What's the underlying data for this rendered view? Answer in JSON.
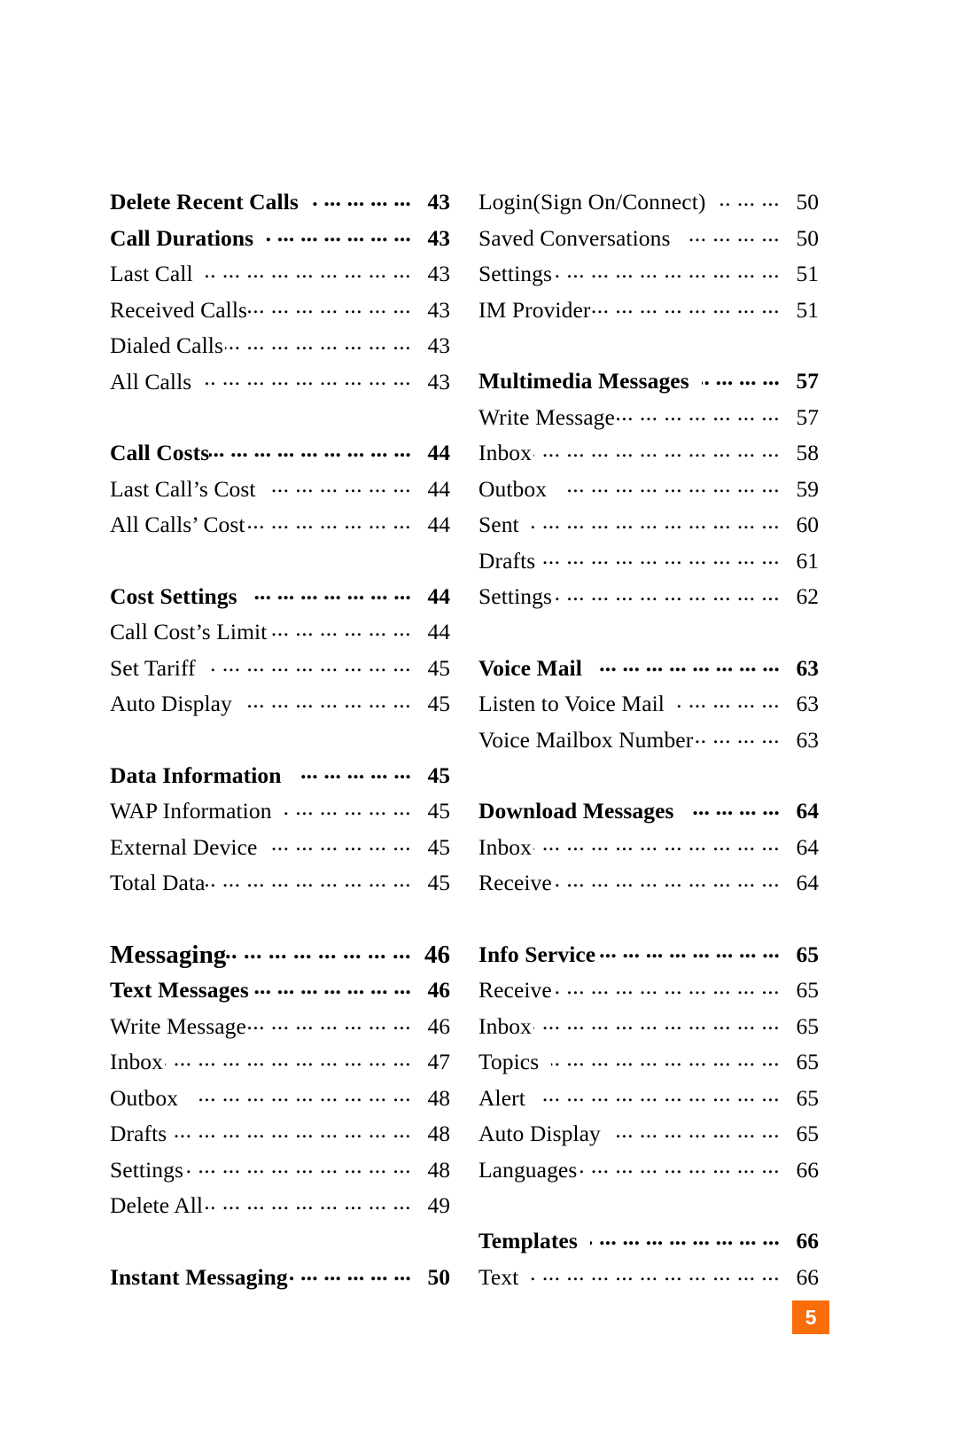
{
  "page": {
    "number": "5",
    "badge_color": "#f96d0b",
    "badge_text_color": "#ffffff"
  },
  "toc": {
    "left_column": [
      {
        "label": "Delete Recent Calls",
        "page": "43",
        "level": "head",
        "spacing": "none",
        "leader": "wide"
      },
      {
        "label": "Call Durations",
        "page": "43",
        "level": "head",
        "spacing": "none",
        "leader": "wide"
      },
      {
        "label": "Last Call",
        "page": "43",
        "level": "sub",
        "spacing": "none",
        "leader": "wide"
      },
      {
        "label": "Received Calls",
        "page": "43",
        "level": "sub",
        "spacing": "none",
        "leader": "tight"
      },
      {
        "label": "Dialed Calls",
        "page": "43",
        "level": "sub",
        "spacing": "none",
        "leader": "normal"
      },
      {
        "label": "All Calls",
        "page": "43",
        "level": "sub",
        "spacing": "none",
        "leader": "wide"
      },
      {
        "label": "Call Costs",
        "page": "44",
        "level": "head",
        "spacing": "gap",
        "leader": "tight"
      },
      {
        "label": "Last Call’s Cost",
        "page": "44",
        "level": "sub",
        "spacing": "none",
        "leader": "wide"
      },
      {
        "label": "All Calls’ Cost",
        "page": "44",
        "level": "sub",
        "spacing": "none",
        "leader": "normal"
      },
      {
        "label": "Cost Settings",
        "page": "44",
        "level": "head",
        "spacing": "gap",
        "leader": "wide"
      },
      {
        "label": "Call Cost’s Limit",
        "page": "44",
        "level": "sub",
        "spacing": "none",
        "leader": "normal"
      },
      {
        "label": "Set Tariff",
        "page": "45",
        "level": "sub",
        "spacing": "none",
        "leader": "wide"
      },
      {
        "label": "Auto Display",
        "page": "45",
        "level": "sub",
        "spacing": "none",
        "leader": "wide"
      },
      {
        "label": "Data Information",
        "page": "45",
        "level": "head",
        "spacing": "gap",
        "leader": "wide"
      },
      {
        "label": "WAP Information",
        "page": "45",
        "level": "sub",
        "spacing": "none",
        "leader": "wide"
      },
      {
        "label": "External Device",
        "page": "45",
        "level": "sub",
        "spacing": "none",
        "leader": "wide"
      },
      {
        "label": "Total Data",
        "page": "45",
        "level": "sub",
        "spacing": "none",
        "leader": "tight"
      },
      {
        "label": "Messaging",
        "page": "46",
        "level": "major",
        "spacing": "gap",
        "leader": "tight"
      },
      {
        "label": "Text Messages",
        "page": "46",
        "level": "head",
        "spacing": "none",
        "leader": "tight"
      },
      {
        "label": "Write Message",
        "page": "46",
        "level": "sub",
        "spacing": "none",
        "leader": "normal"
      },
      {
        "label": "Inbox",
        "page": "47",
        "level": "sub",
        "spacing": "none",
        "leader": "normal"
      },
      {
        "label": "Outbox",
        "page": "48",
        "level": "sub",
        "spacing": "none",
        "leader": "wide"
      },
      {
        "label": "Drafts",
        "page": "48",
        "level": "sub",
        "spacing": "none",
        "leader": "tight"
      },
      {
        "label": "Settings",
        "page": "48",
        "level": "sub",
        "spacing": "none",
        "leader": "normal"
      },
      {
        "label": "Delete All",
        "page": "49",
        "level": "sub",
        "spacing": "none",
        "leader": "normal"
      },
      {
        "label": "Instant Messaging",
        "page": "50",
        "level": "head",
        "spacing": "gap",
        "leader": "normal"
      }
    ],
    "right_column": [
      {
        "label": "Login(Sign On/Connect)",
        "page": "50",
        "level": "sub",
        "spacing": "none",
        "leader": "wide"
      },
      {
        "label": "Saved Conversations",
        "page": "50",
        "level": "sub",
        "spacing": "none",
        "leader": "wide"
      },
      {
        "label": "Settings",
        "page": "51",
        "level": "sub",
        "spacing": "none",
        "leader": "normal"
      },
      {
        "label": "IM Provider",
        "page": "51",
        "level": "sub",
        "spacing": "none",
        "leader": "normal"
      },
      {
        "label": "Multimedia Messages",
        "page": "57",
        "level": "head",
        "spacing": "gap",
        "leader": "wide"
      },
      {
        "label": "Write Message",
        "page": "57",
        "level": "sub",
        "spacing": "none",
        "leader": "normal"
      },
      {
        "label": "Inbox",
        "page": "58",
        "level": "sub",
        "spacing": "none",
        "leader": "normal"
      },
      {
        "label": "Outbox",
        "page": "59",
        "level": "sub",
        "spacing": "none",
        "leader": "wide"
      },
      {
        "label": "Sent",
        "page": "60",
        "level": "sub",
        "spacing": "none",
        "leader": "wide"
      },
      {
        "label": "Drafts",
        "page": "61",
        "level": "sub",
        "spacing": "none",
        "leader": "tight"
      },
      {
        "label": "Settings",
        "page": "62",
        "level": "sub",
        "spacing": "none",
        "leader": "normal"
      },
      {
        "label": "Voice Mail",
        "page": "63",
        "level": "head",
        "spacing": "gap",
        "leader": "wide"
      },
      {
        "label": "Listen to Voice Mail",
        "page": "63",
        "level": "sub",
        "spacing": "none",
        "leader": "wide"
      },
      {
        "label": "Voice Mailbox Number",
        "page": "63",
        "level": "sub",
        "spacing": "none",
        "leader": "normal"
      },
      {
        "label": "Download Messages",
        "page": "64",
        "level": "head",
        "spacing": "gap",
        "leader": "wide"
      },
      {
        "label": "Inbox",
        "page": "64",
        "level": "sub",
        "spacing": "none",
        "leader": "normal"
      },
      {
        "label": "Receive",
        "page": "64",
        "level": "sub",
        "spacing": "none",
        "leader": "normal"
      },
      {
        "label": "Info Service",
        "page": "65",
        "level": "head",
        "spacing": "gap",
        "leader": "tight"
      },
      {
        "label": "Receive",
        "page": "65",
        "level": "sub",
        "spacing": "none",
        "leader": "normal"
      },
      {
        "label": "Inbox",
        "page": "65",
        "level": "sub",
        "spacing": "none",
        "leader": "normal"
      },
      {
        "label": "Topics",
        "page": "65",
        "level": "sub",
        "spacing": "none",
        "leader": "wide"
      },
      {
        "label": "Alert",
        "page": "65",
        "level": "sub",
        "spacing": "none",
        "leader": "wide"
      },
      {
        "label": "Auto Display",
        "page": "65",
        "level": "sub",
        "spacing": "none",
        "leader": "wide"
      },
      {
        "label": "Languages",
        "page": "66",
        "level": "sub",
        "spacing": "none",
        "leader": "tight"
      },
      {
        "label": "Templates",
        "page": "66",
        "level": "head",
        "spacing": "gap",
        "leader": "wide"
      },
      {
        "label": "Text",
        "page": "66",
        "level": "sub",
        "spacing": "none",
        "leader": "wide"
      }
    ]
  }
}
